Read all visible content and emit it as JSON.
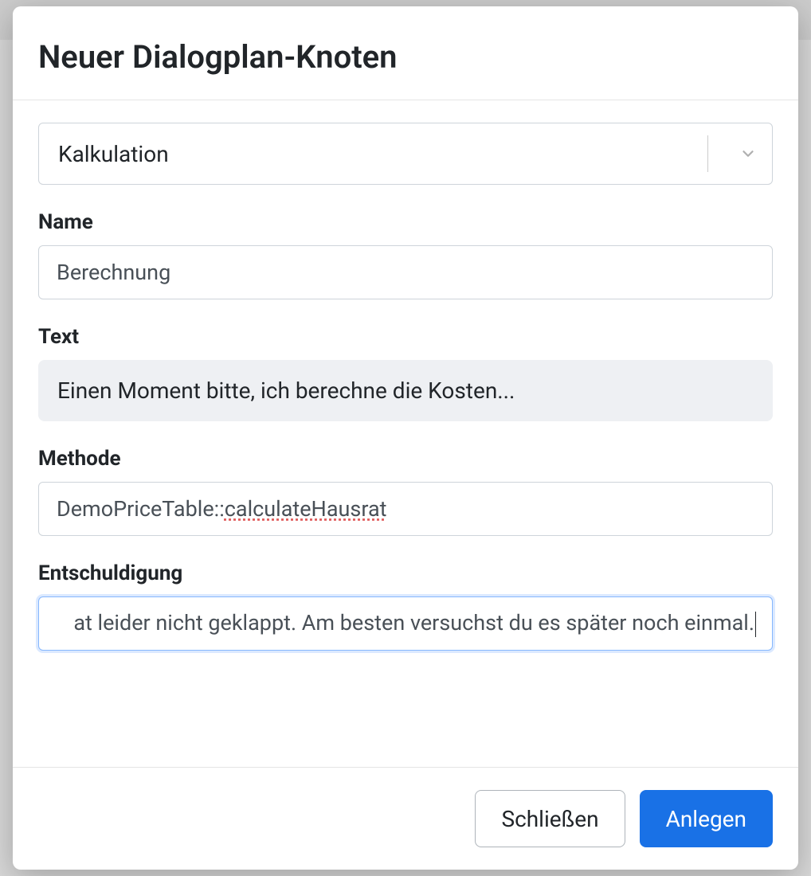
{
  "modal": {
    "title": "Neuer Dialogplan-Knoten",
    "type_dropdown": {
      "selected": "Kalkulation"
    },
    "fields": {
      "name": {
        "label": "Name",
        "value": "Berechnung"
      },
      "text": {
        "label": "Text",
        "value": "Einen Moment bitte, ich berechne die Kosten..."
      },
      "method": {
        "label": "Methode",
        "prefix": "DemoPriceTable::",
        "suffix": "calculateHausrat"
      },
      "apology": {
        "label": "Entschuldigung",
        "value": "at leider nicht geklappt. Am besten versuchst du es später noch einmal."
      }
    },
    "footer": {
      "close_label": "Schließen",
      "create_label": "Anlegen"
    }
  }
}
